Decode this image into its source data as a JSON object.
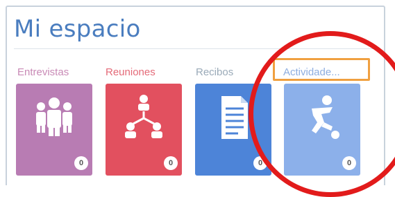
{
  "panel": {
    "title": "Mi espacio"
  },
  "tiles": [
    {
      "label": "Entrevistas",
      "label_color": "#c98ab6",
      "color": "#b87cb3",
      "badge": "0",
      "icon": "people-group-icon"
    },
    {
      "label": "Reuniones",
      "label_color": "#e46a78",
      "color": "#e2505f",
      "badge": "0",
      "icon": "meeting-network-icon"
    },
    {
      "label": "Recibos",
      "label_color": "#9aaab8",
      "color": "#4d84d8",
      "badge": "0",
      "icon": "document-icon"
    },
    {
      "label": "Actividade...",
      "label_color": "#8eaee0",
      "color": "#8cb0ea",
      "badge": "0",
      "icon": "soccer-player-icon"
    }
  ],
  "colors": {
    "highlight_box": "#f0a040",
    "annotation_circle": "#e21b1b",
    "title": "#4a7dbf"
  }
}
